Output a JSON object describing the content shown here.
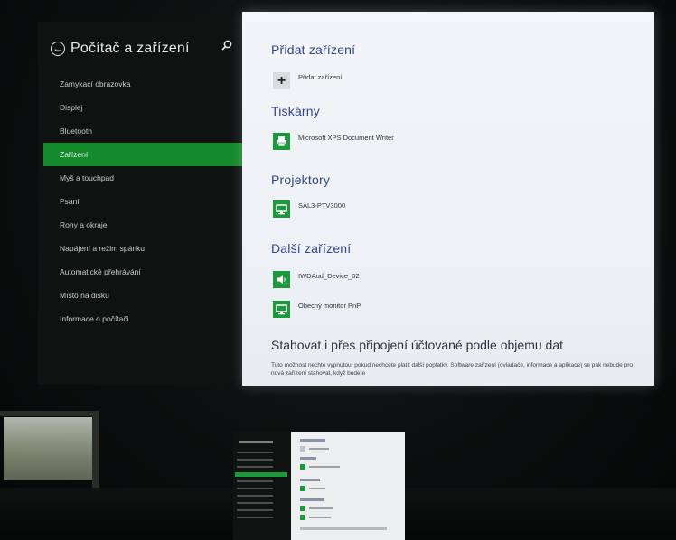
{
  "sidebar": {
    "title": "Počítač a zařízení",
    "items": [
      {
        "label": "Zamykací obrazovka",
        "selected": false
      },
      {
        "label": "Displej",
        "selected": false
      },
      {
        "label": "Bluetooth",
        "selected": false
      },
      {
        "label": "Zařízení",
        "selected": true
      },
      {
        "label": "Myš a touchpad",
        "selected": false
      },
      {
        "label": "Psaní",
        "selected": false
      },
      {
        "label": "Rohy a okraje",
        "selected": false
      },
      {
        "label": "Napájení a režim spánku",
        "selected": false
      },
      {
        "label": "Automatické přehrávání",
        "selected": false
      },
      {
        "label": "Místo na disku",
        "selected": false
      },
      {
        "label": "Informace o počítači",
        "selected": false
      }
    ]
  },
  "main": {
    "add_section": {
      "title": "Přidat zařízení",
      "button_label": "Přidat zařízení"
    },
    "printers": {
      "title": "Tiskárny",
      "devices": [
        "Microsoft XPS Document Writer"
      ]
    },
    "projectors": {
      "title": "Projektory",
      "devices": [
        "SAL3-PTV3000"
      ]
    },
    "other": {
      "title": "Další zařízení",
      "devices": [
        "IWDAud_Device_02",
        "Obecný monitor PnP"
      ]
    },
    "metered": {
      "title": "Stahovat i přes připojení účtované podle objemu dat",
      "description": "Tuto možnost nechte vypnutou, pokud nechcete platit další poplatky. Software zařízení (ovladače, informace a aplikace) se pak nebude pro nová zařízení stahovat, když budete"
    }
  },
  "colors": {
    "accent": "#148a2a",
    "section_title": "#32458a",
    "sidebar_bg": "#0e1211"
  }
}
